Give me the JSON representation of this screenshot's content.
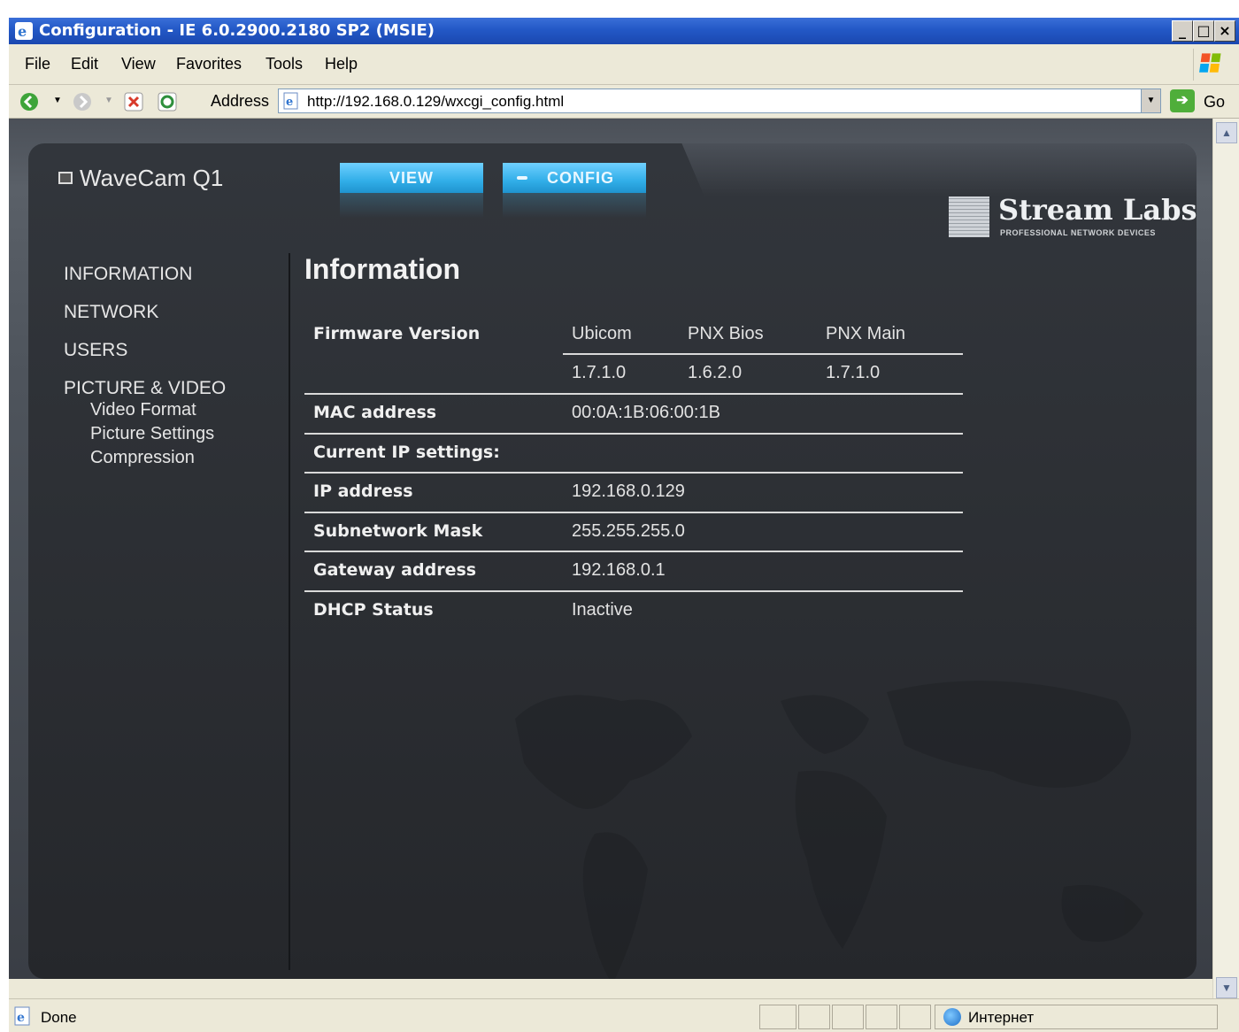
{
  "window": {
    "title": "Configuration - IE 6.0.2900.2180 SP2 (MSIE)",
    "controls": [
      "_",
      "□",
      "×"
    ]
  },
  "menubar": {
    "items": [
      "File",
      "Edit",
      "View",
      "Favorites",
      "Tools",
      "Help"
    ]
  },
  "addressbar": {
    "label": "Address",
    "url": "http://192.168.0.129/wxcgi_config.html",
    "go_label": "Go"
  },
  "device": {
    "name": "WaveCam Q1"
  },
  "tabs": {
    "view": "VIEW",
    "config": "CONFIG"
  },
  "brand": {
    "name": "Stream Labs",
    "tagline": "PROFESSIONAL  NETWORK  DEVICES"
  },
  "sidebar": {
    "items": [
      "INFORMATION",
      "NETWORK",
      "USERS",
      "PICTURE & VIDEO"
    ],
    "subitems": [
      "Video Format",
      "Picture Settings",
      "Compression"
    ]
  },
  "main": {
    "heading": "Information",
    "firmware": {
      "label": "Firmware Version",
      "columns": [
        "Ubicom",
        "PNX Bios",
        "PNX Main"
      ],
      "versions": [
        "1.7.1.0",
        "1.6.2.0",
        "1.7.1.0"
      ]
    },
    "rows": [
      {
        "label": "MAC address",
        "value": "00:0A:1B:06:00:1B"
      },
      {
        "label": "Current IP settings:",
        "value": ""
      },
      {
        "label": "IP address",
        "value": "192.168.0.129"
      },
      {
        "label": "Subnetwork Mask",
        "value": "255.255.255.0"
      },
      {
        "label": "Gateway address",
        "value": "192.168.0.1"
      },
      {
        "label": "DHCP Status",
        "value": "Inactive"
      }
    ]
  },
  "statusbar": {
    "status": "Done",
    "zone": "Интернет"
  }
}
